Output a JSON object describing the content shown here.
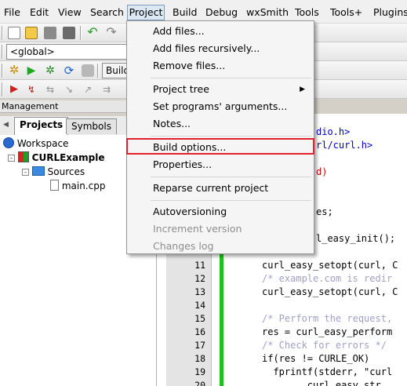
{
  "menubar": {
    "items": [
      "File",
      "Edit",
      "View",
      "Search",
      "Project",
      "Build",
      "Debug",
      "wxSmith",
      "Tools",
      "Tools+",
      "Plugins"
    ],
    "open_item": "Project"
  },
  "toolbar": {
    "scope_combo": "<global>",
    "build_label": "Build"
  },
  "management": {
    "title": "Management",
    "tabs": [
      "Projects",
      "Symbols"
    ],
    "active_tab": "Projects",
    "tree": {
      "workspace": "Workspace",
      "project": "CURLExample",
      "folder": "Sources",
      "file": "main.cpp"
    }
  },
  "project_menu": {
    "items": [
      {
        "label": "Add files...",
        "enabled": true
      },
      {
        "label": "Add files recursively...",
        "enabled": true
      },
      {
        "label": "Remove files...",
        "enabled": true
      },
      {
        "label": "Project tree",
        "enabled": true,
        "submenu": true
      },
      {
        "label": "Set programs' arguments...",
        "enabled": true
      },
      {
        "label": "Notes...",
        "enabled": true
      },
      {
        "label": "Build options...",
        "enabled": true,
        "highlighted": true
      },
      {
        "label": "Properties...",
        "enabled": true
      },
      {
        "label": "Reparse current project",
        "enabled": true
      },
      {
        "label": "Autoversioning",
        "enabled": true
      },
      {
        "label": "Increment version",
        "enabled": false
      },
      {
        "label": "Changes log",
        "enabled": false
      }
    ],
    "submenu_arrow": "triangle-right-icon"
  },
  "editor": {
    "partial_lines": [
      {
        "text": "dio.h>"
      },
      {
        "text": "rl/curl.h>"
      },
      {
        "text": "d)"
      },
      {
        "text": "es;"
      },
      {
        "text": "l_easy_init();"
      }
    ],
    "lines": [
      {
        "num": "11",
        "text": "curl_easy_setopt(curl, C"
      },
      {
        "num": "12",
        "text": "/* example.com is redir"
      },
      {
        "num": "13",
        "text": "curl_easy_setopt(curl, C"
      },
      {
        "num": "14",
        "text": ""
      },
      {
        "num": "15",
        "text": "/* Perform the request,"
      },
      {
        "num": "16",
        "text": "res = curl_easy_perform"
      },
      {
        "num": "17",
        "text": "/* Check for errors */"
      },
      {
        "num": "18",
        "text": "if(res != CURLE_OK)"
      },
      {
        "num": "19",
        "text": "  fprintf(stderr, \"curl"
      },
      {
        "num": "20",
        "text": "        curl_easy_str"
      }
    ]
  },
  "colors": {
    "highlight_box": "#e0202c",
    "change_bar": "#20c020",
    "comment": "#a0a0c8",
    "string": "#0000c8"
  }
}
